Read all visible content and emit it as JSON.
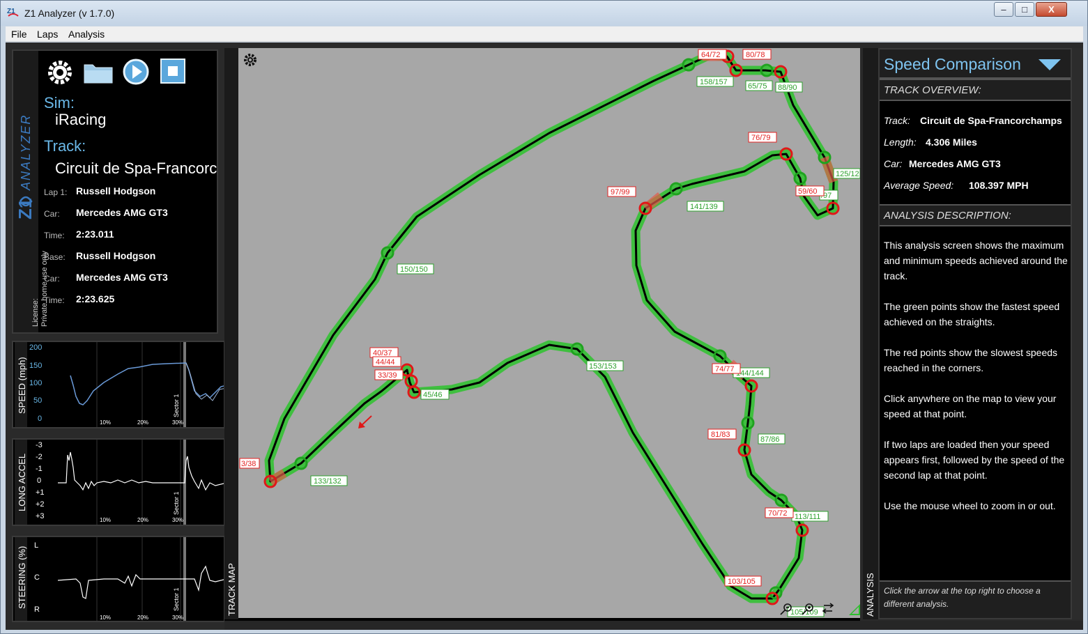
{
  "window": {
    "title": "Z1 Analyzer (v 1.7.0)",
    "min": "–",
    "max": "□",
    "close": "X"
  },
  "menu": {
    "file": "File",
    "laps": "Laps",
    "analysis": "Analysis"
  },
  "info": {
    "license": "License:\nPrivate home use only",
    "sim_label": "Sim:",
    "sim_value": "iRacing",
    "track_label": "Track:",
    "track_value": "Circuit de Spa-Francorchamps",
    "lap_label": "Lap 1:",
    "lap_driver": "Russell Hodgson",
    "car_label": "Car:",
    "lap_car": "Mercedes AMG GT3",
    "time_label": "Time:",
    "lap_time": "2:23.011",
    "base_label": "Base:",
    "base_driver": "Russell Hodgson",
    "base_car": "Mercedes AMG GT3",
    "base_time": "2:23.625"
  },
  "graphs": {
    "speed": {
      "label": "SPEED (mph)",
      "ticks": [
        "200",
        "150",
        "100",
        "50",
        "0"
      ]
    },
    "accel": {
      "label": "LONG ACCEL",
      "ticks": [
        "-3",
        "-2",
        "-1",
        "0",
        "+1",
        "+2",
        "+3"
      ]
    },
    "steer": {
      "label": "STEERING (%)",
      "ticks": [
        "L",
        "C",
        "R"
      ]
    },
    "x_ticks": [
      "10%",
      "20%",
      "30%"
    ],
    "sector": "Sector 1"
  },
  "map": {
    "side_label": "TRACK MAP",
    "labels_green": [
      "158/157",
      "65/75",
      "88/90",
      "125/12",
      "141/139",
      "/97",
      "150/150",
      "45/46",
      "153/153",
      "144/144",
      "87/86",
      "113/111",
      "133/132",
      "105/109"
    ],
    "labels_red": [
      "64/72",
      "80/78",
      "76/79",
      "97/99",
      "59/60",
      "40/37",
      "44/44",
      "33/39",
      "74/77",
      "81/83",
      "70/72",
      "103/105",
      "3/38"
    ]
  },
  "right": {
    "side_label": "ANALYSIS",
    "title": "Speed Comparison",
    "overview_h": "TRACK OVERVIEW:",
    "track_k": "Track:",
    "track_v": "Circuit de Spa-Francorchamps",
    "length_k": "Length:",
    "length_v": "4.306 Miles",
    "car_k": "Car:",
    "car_v": "Mercedes AMG GT3",
    "avg_k": "Average Speed:",
    "avg_v": "108.397 MPH",
    "desc_h": "ANALYSIS DESCRIPTION:",
    "p1": "This analysis screen shows the maximum and minimum speeds achieved around the track.",
    "p2": "The green points show the fastest speed achieved on the straights.",
    "p3": "The red points show the slowest speeds reached in the corners.",
    "p4": "Click anywhere on the map to view your speed at that point.",
    "p5": "If two laps are loaded then your speed appears first, followed by the speed of the second lap at that point.",
    "p6": "Use the mouse wheel to zoom in or out.",
    "foot": "Click the arrow at the top right to choose a different analysis."
  },
  "colors": {
    "accent": "#7ec3ef",
    "green": "#2ea12e",
    "red": "#e32020",
    "map_bg": "#a7a7a7"
  }
}
